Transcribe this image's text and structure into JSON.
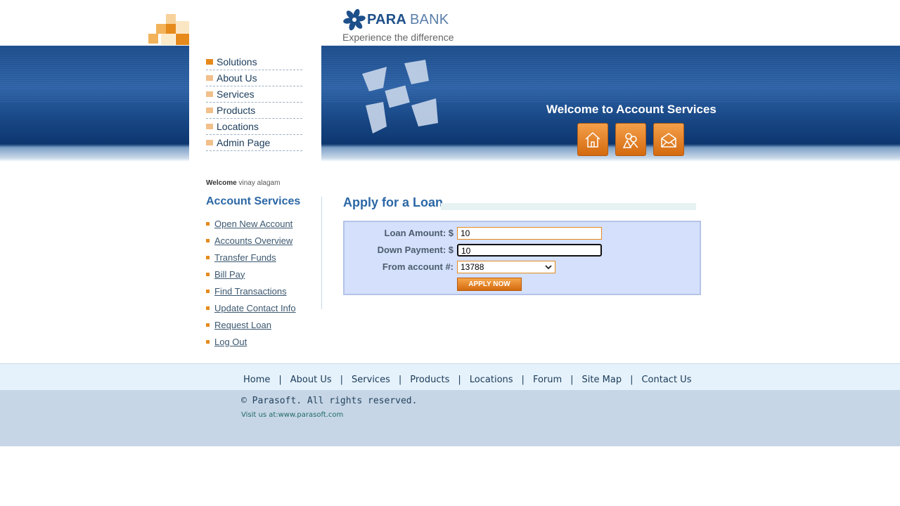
{
  "brand": {
    "name_part1": "PARA",
    "name_part2": "BANK",
    "tagline": "Experience the difference"
  },
  "topnav": [
    "Solutions",
    "About Us",
    "Services",
    "Products",
    "Locations",
    "Admin Page"
  ],
  "header": {
    "welcome_banner": "Welcome to Account Services",
    "icons": [
      "home-icon",
      "contact-icon",
      "mail-icon"
    ]
  },
  "sidebar": {
    "welcome_label": "Welcome",
    "user_name": "vinay alagam",
    "title": "Account Services",
    "links": [
      "Open New Account",
      "Accounts Overview",
      "Transfer Funds",
      "Bill Pay",
      "Find Transactions",
      "Update Contact Info",
      "Request Loan",
      "Log Out"
    ]
  },
  "main": {
    "title": "Apply for a Loan",
    "loan_amount_label": "Loan Amount: $",
    "loan_amount_value": "10",
    "down_payment_label": "Down Payment: $",
    "down_payment_value": "10",
    "from_account_label": "From account #:",
    "from_account_value": "13788",
    "apply_button": "APPLY NOW"
  },
  "footer": {
    "links": [
      "Home",
      "About Us",
      "Services",
      "Products",
      "Locations",
      "Forum",
      "Site Map",
      "Contact Us"
    ],
    "separator": "|",
    "copyright": "© Parasoft. All rights reserved.",
    "visit": "Visit us at:www.parasoft.com"
  },
  "colors": {
    "accent_orange": "#e68a1c",
    "brand_blue": "#1d4f8a",
    "title_blue": "#2b67a6",
    "form_bg": "#d4e0fc"
  }
}
